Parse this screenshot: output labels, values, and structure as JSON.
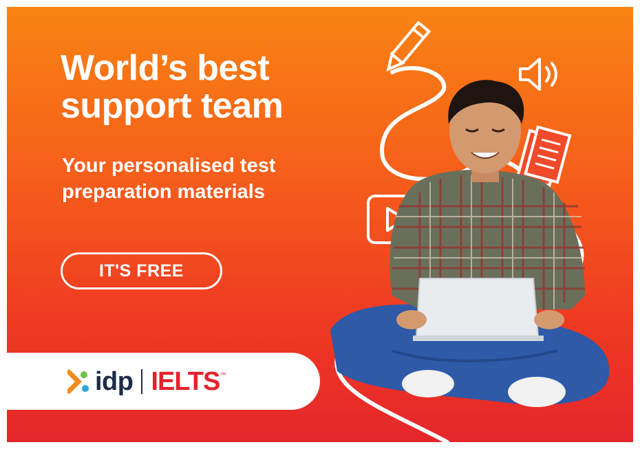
{
  "ad": {
    "headline_line1": "World’s best",
    "headline_line2": "support team",
    "subhead_line1": "Your personalised test",
    "subhead_line2": "preparation materials",
    "cta_label": "IT'S FREE",
    "brand_primary": "idp",
    "brand_secondary": "IELTS",
    "trademark": "™"
  },
  "colors": {
    "gradient_top": "#f98313",
    "gradient_bottom": "#e5262b",
    "idp_navy": "#1d2b47",
    "ielts_red": "#e4222c",
    "white": "#ffffff"
  },
  "icons": [
    "pencil-icon",
    "speaker-icon",
    "document-icon",
    "video-camera-icon",
    "idp-logo-icon"
  ]
}
